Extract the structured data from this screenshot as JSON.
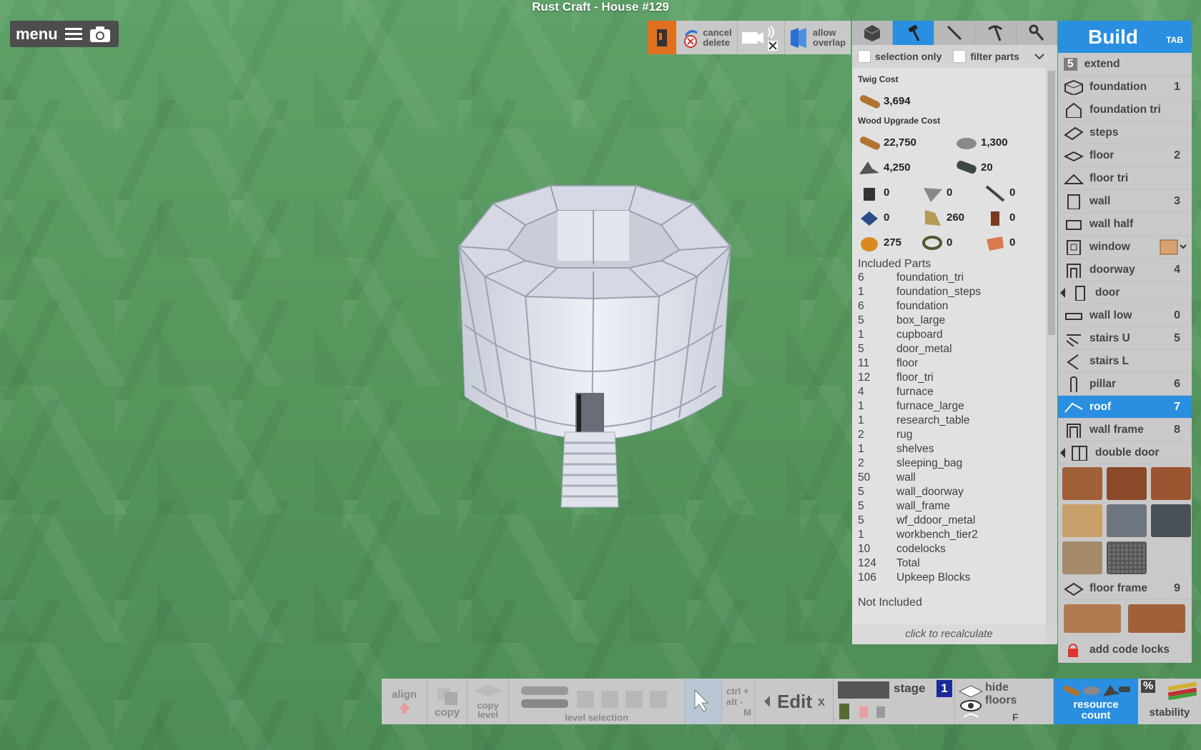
{
  "title": "Rust Craft - House #129",
  "menu": {
    "label": "menu"
  },
  "toolbar": {
    "cancel_delete": [
      "cancel",
      "delete"
    ],
    "allow_overlap": [
      "allow",
      "overlap"
    ]
  },
  "filters": {
    "selection_only": "selection only",
    "filter_parts": "filter parts"
  },
  "costs": {
    "twig_header": "Twig Cost",
    "twig_wood": "3,694",
    "wood_header": "Wood Upgrade Cost",
    "rows": [
      [
        "22,750",
        "1,300"
      ],
      [
        "4,250",
        "20"
      ],
      [
        "0",
        "0",
        "0"
      ],
      [
        "0",
        "260",
        "0"
      ],
      [
        "275",
        "0",
        "0"
      ]
    ]
  },
  "included_header": "Included Parts",
  "parts": [
    [
      "6",
      "foundation_tri"
    ],
    [
      "1",
      "foundation_steps"
    ],
    [
      "6",
      "foundation"
    ],
    [
      "5",
      "box_large"
    ],
    [
      "1",
      "cupboard"
    ],
    [
      "5",
      "door_metal"
    ],
    [
      "11",
      "floor"
    ],
    [
      "12",
      "floor_tri"
    ],
    [
      "4",
      "furnace"
    ],
    [
      "1",
      "furnace_large"
    ],
    [
      "1",
      "research_table"
    ],
    [
      "2",
      "rug"
    ],
    [
      "1",
      "shelves"
    ],
    [
      "2",
      "sleeping_bag"
    ],
    [
      "50",
      "wall"
    ],
    [
      "5",
      "wall_doorway"
    ],
    [
      "5",
      "wall_frame"
    ],
    [
      "5",
      "wf_ddoor_metal"
    ],
    [
      "1",
      "workbench_tier2"
    ],
    [
      "10",
      "codelocks"
    ],
    [
      "124",
      "Total"
    ],
    [
      "106",
      "Upkeep Blocks"
    ]
  ],
  "not_included": "Not Included",
  "recalc": "click to recalculate",
  "build": {
    "title": "Build",
    "tab": "TAB",
    "extend_num": "5",
    "extend": "extend",
    "items": [
      {
        "label": "foundation",
        "num": "1"
      },
      {
        "label": "foundation tri",
        "num": ""
      },
      {
        "label": "steps",
        "num": ""
      },
      {
        "label": "floor",
        "num": "2"
      },
      {
        "label": "floor tri",
        "num": ""
      },
      {
        "label": "wall",
        "num": "3"
      },
      {
        "label": "wall half",
        "num": ""
      },
      {
        "label": "window",
        "num": ""
      },
      {
        "label": "doorway",
        "num": "4"
      },
      {
        "label": "door",
        "num": ""
      },
      {
        "label": "wall low",
        "num": "0"
      },
      {
        "label": "stairs U",
        "num": "5"
      },
      {
        "label": "stairs L",
        "num": ""
      },
      {
        "label": "pillar",
        "num": "6"
      },
      {
        "label": "roof",
        "num": "7"
      },
      {
        "label": "wall frame",
        "num": "8"
      },
      {
        "label": "double door",
        "num": ""
      }
    ],
    "floor_frame": "floor frame",
    "floor_frame_num": "9",
    "add_code_locks": "add code locks"
  },
  "bottom": {
    "align": "align",
    "copy": "copy",
    "copy_level": [
      "copy",
      "level"
    ],
    "level_selection": "level selection",
    "ctrl": "ctrl +",
    "alt": "alt -",
    "m": "M",
    "edit": "Edit",
    "x": "x",
    "stage": "stage",
    "stage_num": "1",
    "hide_floors": [
      "hide",
      "floors"
    ],
    "f": "F",
    "resource_count": [
      "resource",
      "count"
    ],
    "pct": "%",
    "stability": "stability"
  }
}
